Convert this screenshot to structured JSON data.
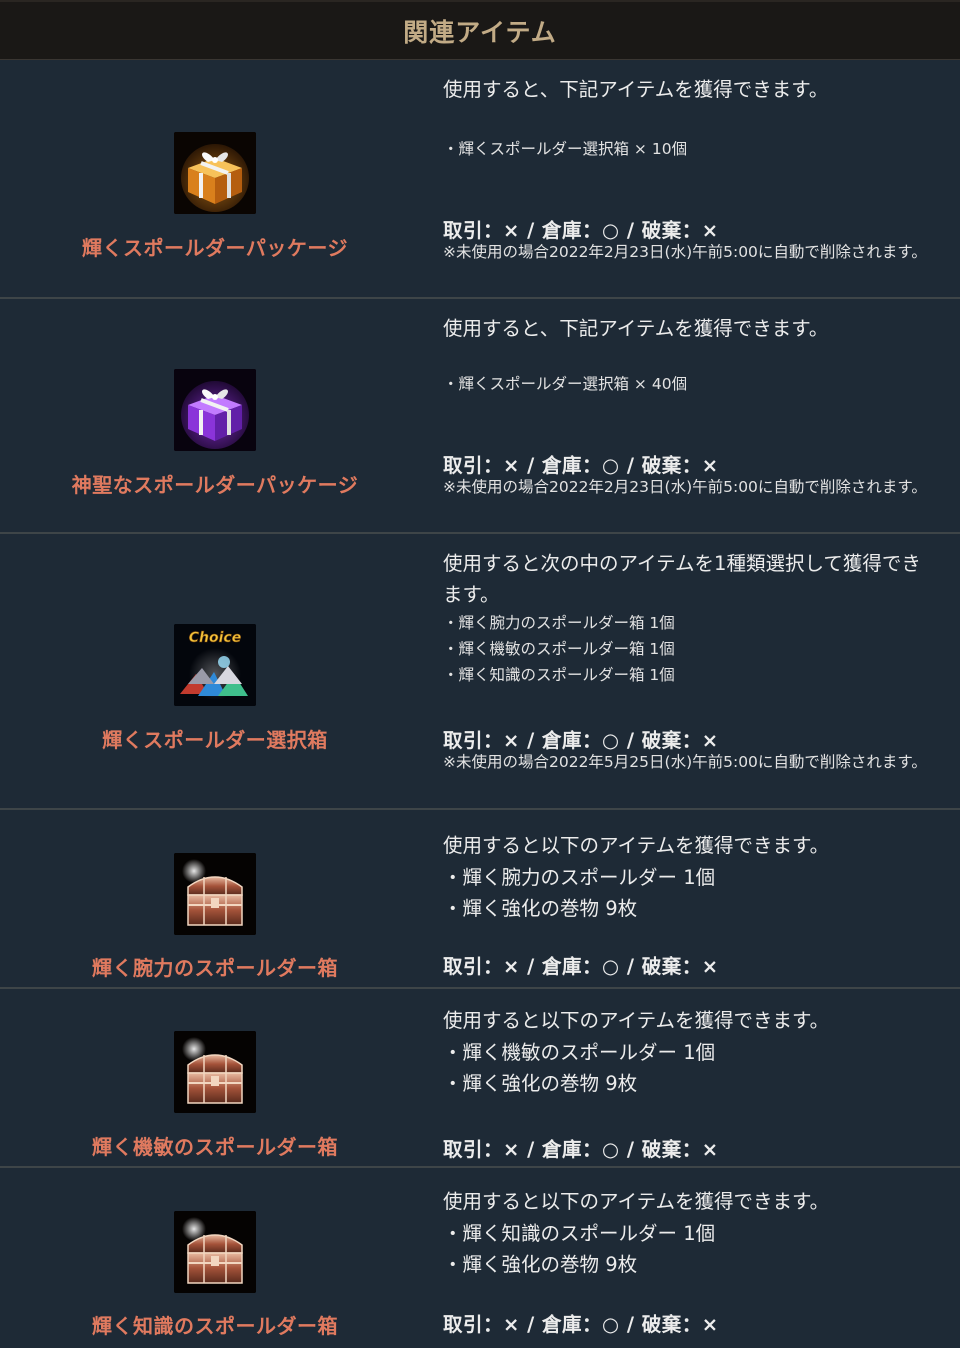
{
  "header": {
    "title": "関連アイテム"
  },
  "items": [
    {
      "name": "輝くスポールダーパッケージ",
      "icon": "gift-orange-icon",
      "description": "使用すると、下記アイテムを獲得できます。",
      "contents": [
        "・輝くスポールダー選択箱 × 10個"
      ],
      "trade": "取引：× / 倉庫：○ / 破棄：×",
      "note": "※未使用の場合2022年2月23日(水)午前5:00に自動で削除されます。"
    },
    {
      "name": "神聖なスポールダーパッケージ",
      "icon": "gift-purple-icon",
      "description": "使用すると、下記アイテムを獲得できます。",
      "contents": [
        "・輝くスポールダー選択箱 × 40個"
      ],
      "trade": "取引：× / 倉庫：○ / 破棄：×",
      "note": "※未使用の場合2022年2月23日(水)午前5:00に自動で削除されます。"
    },
    {
      "name": "輝くスポールダー選択箱",
      "icon": "choice-box-icon",
      "icon_label": "Choice",
      "description": "使用すると次の中のアイテムを1種類選択して獲得できます。",
      "contents": [
        "・輝く腕力のスポールダー箱 1個",
        "・輝く機敏のスポールダー箱 1個",
        "・輝く知識のスポールダー箱 1個"
      ],
      "trade": "取引：× / 倉庫：○ / 破棄：×",
      "note": "※未使用の場合2022年5月25日(水)午前5:00に自動で削除されます。"
    },
    {
      "name": "輝く腕力のスポールダー箱",
      "icon": "treasure-chest-icon",
      "description": "使用すると以下のアイテムを獲得できます。",
      "contents": [
        "・輝く腕力のスポールダー 1個",
        "・輝く強化の巻物 9枚"
      ],
      "trade": "取引：× / 倉庫：○ / 破棄：×"
    },
    {
      "name": "輝く機敏のスポールダー箱",
      "icon": "treasure-chest-icon",
      "description": "使用すると以下のアイテムを獲得できます。",
      "contents": [
        "・輝く機敏のスポールダー 1個",
        "・輝く強化の巻物 9枚"
      ],
      "trade": "取引：× / 倉庫：○ / 破棄：×"
    },
    {
      "name": "輝く知識のスポールダー箱",
      "icon": "treasure-chest-icon",
      "description": "使用すると以下のアイテムを獲得できます。",
      "contents": [
        "・輝く知識のスポールダー 1個",
        "・輝く強化の巻物 9枚"
      ],
      "trade": "取引：× / 倉庫：○ / 破棄：×"
    }
  ],
  "colors": {
    "background": "#1e2a36",
    "header_bg": "#1a1816",
    "header_text": "#c2ab86",
    "item_name": "#e07a5f",
    "divider": "#3e4548"
  }
}
